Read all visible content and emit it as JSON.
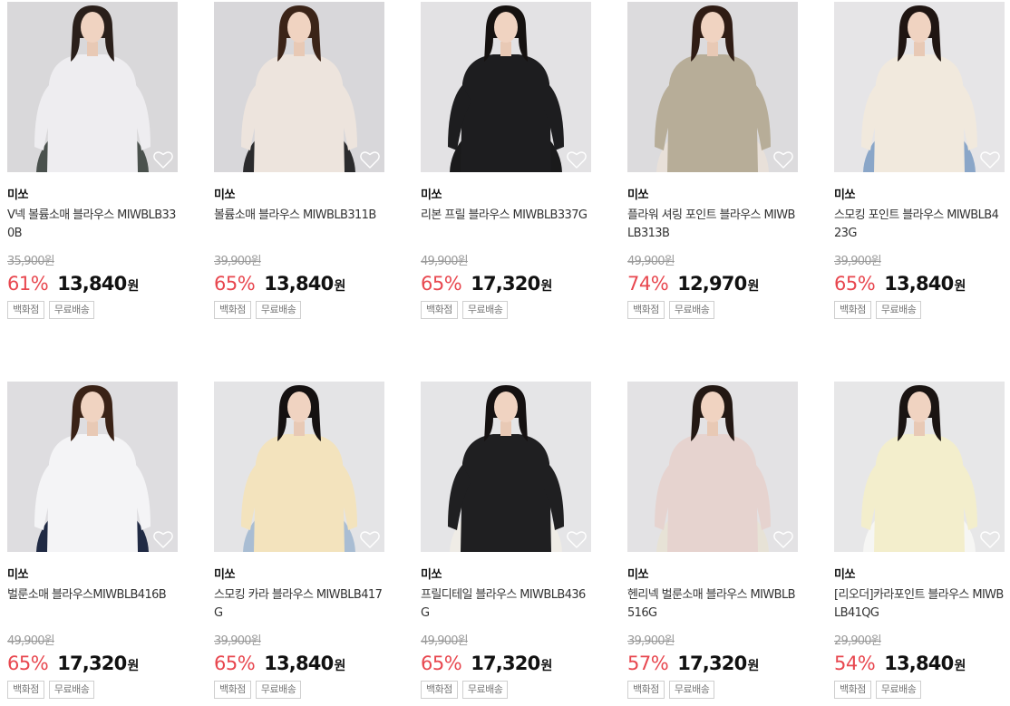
{
  "products": [
    {
      "brand": "미쏘",
      "name": "V넥 볼륨소매 블라우스 MIWBLB330B",
      "orig": "35,900원",
      "discount": "61%",
      "price": "13,840",
      "won": "원",
      "tags": [
        "백화점",
        "무료배송"
      ],
      "top_color": "#eeedf0",
      "bottom_color": "#4a514d",
      "bg": "#d9d8da",
      "hair": "#2a1f1a"
    },
    {
      "brand": "미쏘",
      "name": "볼륨소매 블라우스 MIWBLB311B",
      "orig": "39,900원",
      "discount": "65%",
      "price": "13,840",
      "won": "원",
      "tags": [
        "백화점",
        "무료배송"
      ],
      "top_color": "#ede4dd",
      "bottom_color": "#2b2b2d",
      "bg": "#d8d7da",
      "hair": "#3b2418"
    },
    {
      "brand": "미쏘",
      "name": "리본 프릴 블라우스 MIWBLB337G",
      "orig": "49,900원",
      "discount": "65%",
      "price": "17,320",
      "won": "원",
      "tags": [
        "백화점",
        "무료배송"
      ],
      "top_color": "#1d1d1f",
      "bottom_color": "#1a1a1b",
      "bg": "#e3e2e4",
      "hair": "#161210"
    },
    {
      "brand": "미쏘",
      "name": "플라워 셔링 포인트 블라우스 MIWBLB313B",
      "orig": "49,900원",
      "discount": "74%",
      "price": "12,970",
      "won": "원",
      "tags": [
        "백화점",
        "무료배송"
      ],
      "top_color": "#b7ad98",
      "bottom_color": "#e8e0d9",
      "bg": "#dcdbdd",
      "hair": "#2f1c14"
    },
    {
      "brand": "미쏘",
      "name": "스모킹 포인트 블라우스 MIWBLB423G",
      "orig": "39,900원",
      "discount": "65%",
      "price": "13,840",
      "won": "원",
      "tags": [
        "백화점",
        "무료배송"
      ],
      "top_color": "#f1e9dd",
      "bottom_color": "#8aa6c8",
      "bg": "#e6e5e7",
      "hair": "#1f1512"
    },
    {
      "brand": "미쏘",
      "name": "벌룬소매 블라우스MIWBLB416B",
      "orig": "49,900원",
      "discount": "65%",
      "price": "17,320",
      "won": "원",
      "tags": [
        "백화점",
        "무료배송"
      ],
      "top_color": "#f4f4f6",
      "bottom_color": "#202a44",
      "bg": "#dedde0",
      "hair": "#3a2216"
    },
    {
      "brand": "미쏘",
      "name": "스모킹 카라 블라우스 MIWBLB417G",
      "orig": "39,900원",
      "discount": "65%",
      "price": "13,840",
      "won": "원",
      "tags": [
        "백화점",
        "무료배송"
      ],
      "top_color": "#f3e3bd",
      "bottom_color": "#a9bdd3",
      "bg": "#e4e4e6",
      "hair": "#151111"
    },
    {
      "brand": "미쏘",
      "name": "프릴디테일 블라우스 MIWBLB436G",
      "orig": "49,900원",
      "discount": "65%",
      "price": "17,320",
      "won": "원",
      "tags": [
        "백화점",
        "무료배송"
      ],
      "top_color": "#1f1f21",
      "bottom_color": "#efece6",
      "bg": "#e5e5e7",
      "hair": "#151111"
    },
    {
      "brand": "미쏘",
      "name": "헨리넥 벌룬소매 블라우스 MIWBLB516G",
      "orig": "39,900원",
      "discount": "57%",
      "price": "17,320",
      "won": "원",
      "tags": [
        "백화점",
        "무료배송"
      ],
      "top_color": "#e6d3cf",
      "bottom_color": "#e7e2d6",
      "bg": "#e3e2e4",
      "hair": "#231813"
    },
    {
      "brand": "미쏘",
      "name": "[리오더]카라포인트 블라우스 MIWBLB41QG",
      "orig": "29,900원",
      "discount": "54%",
      "price": "13,840",
      "won": "원",
      "tags": [
        "백화점",
        "무료배송"
      ],
      "top_color": "#f3eecc",
      "bottom_color": "#f6f6f4",
      "bg": "#e7e7e8",
      "hair": "#1a1412"
    }
  ]
}
